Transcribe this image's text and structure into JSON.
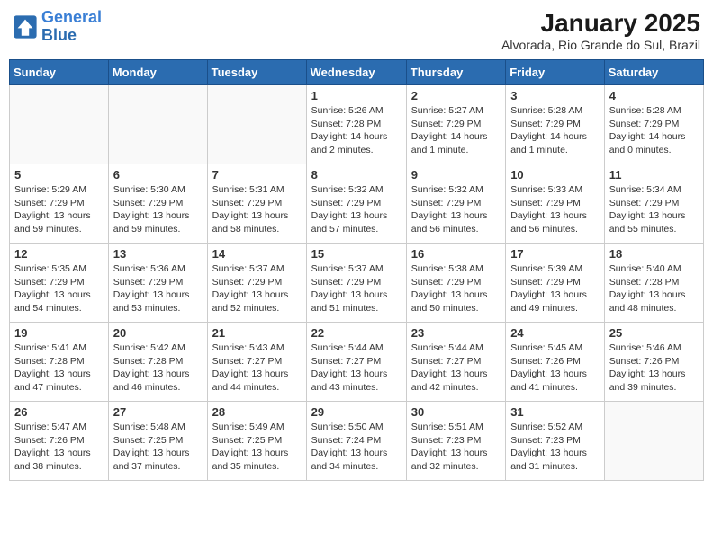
{
  "header": {
    "logo_line1": "General",
    "logo_line2": "Blue",
    "month_title": "January 2025",
    "location": "Alvorada, Rio Grande do Sul, Brazil"
  },
  "weekdays": [
    "Sunday",
    "Monday",
    "Tuesday",
    "Wednesday",
    "Thursday",
    "Friday",
    "Saturday"
  ],
  "weeks": [
    [
      {
        "day": "",
        "sunrise": "",
        "sunset": "",
        "daylight": ""
      },
      {
        "day": "",
        "sunrise": "",
        "sunset": "",
        "daylight": ""
      },
      {
        "day": "",
        "sunrise": "",
        "sunset": "",
        "daylight": ""
      },
      {
        "day": "1",
        "sunrise": "Sunrise: 5:26 AM",
        "sunset": "Sunset: 7:28 PM",
        "daylight": "Daylight: 14 hours and 2 minutes."
      },
      {
        "day": "2",
        "sunrise": "Sunrise: 5:27 AM",
        "sunset": "Sunset: 7:29 PM",
        "daylight": "Daylight: 14 hours and 1 minute."
      },
      {
        "day": "3",
        "sunrise": "Sunrise: 5:28 AM",
        "sunset": "Sunset: 7:29 PM",
        "daylight": "Daylight: 14 hours and 1 minute."
      },
      {
        "day": "4",
        "sunrise": "Sunrise: 5:28 AM",
        "sunset": "Sunset: 7:29 PM",
        "daylight": "Daylight: 14 hours and 0 minutes."
      }
    ],
    [
      {
        "day": "5",
        "sunrise": "Sunrise: 5:29 AM",
        "sunset": "Sunset: 7:29 PM",
        "daylight": "Daylight: 13 hours and 59 minutes."
      },
      {
        "day": "6",
        "sunrise": "Sunrise: 5:30 AM",
        "sunset": "Sunset: 7:29 PM",
        "daylight": "Daylight: 13 hours and 59 minutes."
      },
      {
        "day": "7",
        "sunrise": "Sunrise: 5:31 AM",
        "sunset": "Sunset: 7:29 PM",
        "daylight": "Daylight: 13 hours and 58 minutes."
      },
      {
        "day": "8",
        "sunrise": "Sunrise: 5:32 AM",
        "sunset": "Sunset: 7:29 PM",
        "daylight": "Daylight: 13 hours and 57 minutes."
      },
      {
        "day": "9",
        "sunrise": "Sunrise: 5:32 AM",
        "sunset": "Sunset: 7:29 PM",
        "daylight": "Daylight: 13 hours and 56 minutes."
      },
      {
        "day": "10",
        "sunrise": "Sunrise: 5:33 AM",
        "sunset": "Sunset: 7:29 PM",
        "daylight": "Daylight: 13 hours and 56 minutes."
      },
      {
        "day": "11",
        "sunrise": "Sunrise: 5:34 AM",
        "sunset": "Sunset: 7:29 PM",
        "daylight": "Daylight: 13 hours and 55 minutes."
      }
    ],
    [
      {
        "day": "12",
        "sunrise": "Sunrise: 5:35 AM",
        "sunset": "Sunset: 7:29 PM",
        "daylight": "Daylight: 13 hours and 54 minutes."
      },
      {
        "day": "13",
        "sunrise": "Sunrise: 5:36 AM",
        "sunset": "Sunset: 7:29 PM",
        "daylight": "Daylight: 13 hours and 53 minutes."
      },
      {
        "day": "14",
        "sunrise": "Sunrise: 5:37 AM",
        "sunset": "Sunset: 7:29 PM",
        "daylight": "Daylight: 13 hours and 52 minutes."
      },
      {
        "day": "15",
        "sunrise": "Sunrise: 5:37 AM",
        "sunset": "Sunset: 7:29 PM",
        "daylight": "Daylight: 13 hours and 51 minutes."
      },
      {
        "day": "16",
        "sunrise": "Sunrise: 5:38 AM",
        "sunset": "Sunset: 7:29 PM",
        "daylight": "Daylight: 13 hours and 50 minutes."
      },
      {
        "day": "17",
        "sunrise": "Sunrise: 5:39 AM",
        "sunset": "Sunset: 7:29 PM",
        "daylight": "Daylight: 13 hours and 49 minutes."
      },
      {
        "day": "18",
        "sunrise": "Sunrise: 5:40 AM",
        "sunset": "Sunset: 7:28 PM",
        "daylight": "Daylight: 13 hours and 48 minutes."
      }
    ],
    [
      {
        "day": "19",
        "sunrise": "Sunrise: 5:41 AM",
        "sunset": "Sunset: 7:28 PM",
        "daylight": "Daylight: 13 hours and 47 minutes."
      },
      {
        "day": "20",
        "sunrise": "Sunrise: 5:42 AM",
        "sunset": "Sunset: 7:28 PM",
        "daylight": "Daylight: 13 hours and 46 minutes."
      },
      {
        "day": "21",
        "sunrise": "Sunrise: 5:43 AM",
        "sunset": "Sunset: 7:27 PM",
        "daylight": "Daylight: 13 hours and 44 minutes."
      },
      {
        "day": "22",
        "sunrise": "Sunrise: 5:44 AM",
        "sunset": "Sunset: 7:27 PM",
        "daylight": "Daylight: 13 hours and 43 minutes."
      },
      {
        "day": "23",
        "sunrise": "Sunrise: 5:44 AM",
        "sunset": "Sunset: 7:27 PM",
        "daylight": "Daylight: 13 hours and 42 minutes."
      },
      {
        "day": "24",
        "sunrise": "Sunrise: 5:45 AM",
        "sunset": "Sunset: 7:26 PM",
        "daylight": "Daylight: 13 hours and 41 minutes."
      },
      {
        "day": "25",
        "sunrise": "Sunrise: 5:46 AM",
        "sunset": "Sunset: 7:26 PM",
        "daylight": "Daylight: 13 hours and 39 minutes."
      }
    ],
    [
      {
        "day": "26",
        "sunrise": "Sunrise: 5:47 AM",
        "sunset": "Sunset: 7:26 PM",
        "daylight": "Daylight: 13 hours and 38 minutes."
      },
      {
        "day": "27",
        "sunrise": "Sunrise: 5:48 AM",
        "sunset": "Sunset: 7:25 PM",
        "daylight": "Daylight: 13 hours and 37 minutes."
      },
      {
        "day": "28",
        "sunrise": "Sunrise: 5:49 AM",
        "sunset": "Sunset: 7:25 PM",
        "daylight": "Daylight: 13 hours and 35 minutes."
      },
      {
        "day": "29",
        "sunrise": "Sunrise: 5:50 AM",
        "sunset": "Sunset: 7:24 PM",
        "daylight": "Daylight: 13 hours and 34 minutes."
      },
      {
        "day": "30",
        "sunrise": "Sunrise: 5:51 AM",
        "sunset": "Sunset: 7:23 PM",
        "daylight": "Daylight: 13 hours and 32 minutes."
      },
      {
        "day": "31",
        "sunrise": "Sunrise: 5:52 AM",
        "sunset": "Sunset: 7:23 PM",
        "daylight": "Daylight: 13 hours and 31 minutes."
      },
      {
        "day": "",
        "sunrise": "",
        "sunset": "",
        "daylight": ""
      }
    ]
  ]
}
